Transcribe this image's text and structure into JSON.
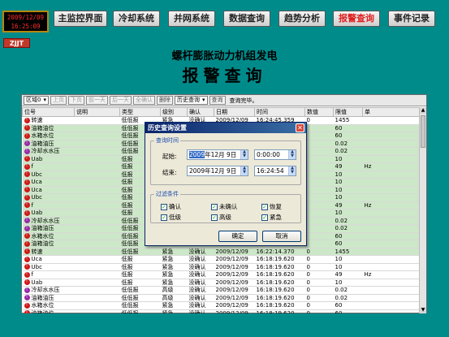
{
  "clock": {
    "date": "2009/12/09",
    "time": "16:25:09"
  },
  "logo": "ZJJT",
  "nav": [
    {
      "label": "主监控界面",
      "active": false
    },
    {
      "label": "冷却系统",
      "active": false
    },
    {
      "label": "并网系统",
      "active": false
    },
    {
      "label": "数据查询",
      "active": false
    },
    {
      "label": "趋势分析",
      "active": false
    },
    {
      "label": "报警查询",
      "active": true
    },
    {
      "label": "事件记录",
      "active": false
    }
  ],
  "title": "螺杆膨胀动力机组发电",
  "subtitle": "报警查询",
  "toolbar": {
    "area_select": "区域0",
    "prev_page": "上页",
    "next_page": "下页",
    "first_day": "前一天",
    "last_day": "后一天",
    "confirm": "全确认",
    "delete": "删除",
    "history": "历史查询",
    "query": "查询",
    "status": "查询完毕。"
  },
  "table": {
    "headers": [
      "位号",
      "说明",
      "类型",
      "级别",
      "确认",
      "日期",
      "时间",
      "数值",
      "限值",
      "单"
    ],
    "rows": [
      {
        "dot": "red",
        "tag": "转速",
        "type": "低低报",
        "level": "紧急",
        "ack": "没确认",
        "date": "2009/12/09",
        "time": "16:24:45.359",
        "value": "0",
        "limit": "1455",
        "unit": ""
      },
      {
        "dot": "red",
        "tag": "油箱油位",
        "type": "低低报",
        "level": "",
        "ack": "",
        "date": "",
        "time": "",
        "value": "",
        "limit": "60",
        "unit": ""
      },
      {
        "dot": "red",
        "tag": "水箱水位",
        "type": "低低报",
        "level": "",
        "ack": "",
        "date": "",
        "time": "",
        "value": "",
        "limit": "60",
        "unit": ""
      },
      {
        "dot": "purple",
        "tag": "油箱油压",
        "type": "低低报",
        "level": "",
        "ack": "",
        "date": "",
        "time": "",
        "value": "",
        "limit": "0.02",
        "unit": ""
      },
      {
        "dot": "purple",
        "tag": "冷却水水压",
        "type": "低低报",
        "level": "",
        "ack": "",
        "date": "",
        "time": "",
        "value": "",
        "limit": "0.02",
        "unit": ""
      },
      {
        "dot": "red",
        "tag": "Uab",
        "type": "低报",
        "level": "",
        "ack": "",
        "date": "",
        "time": "",
        "value": "",
        "limit": "10",
        "unit": ""
      },
      {
        "dot": "red",
        "tag": "f",
        "type": "低报",
        "level": "",
        "ack": "",
        "date": "",
        "time": "",
        "value": "",
        "limit": "49",
        "unit": "Hz"
      },
      {
        "dot": "red",
        "tag": "Ubc",
        "type": "低报",
        "level": "",
        "ack": "",
        "date": "",
        "time": "",
        "value": "",
        "limit": "10",
        "unit": ""
      },
      {
        "dot": "red",
        "tag": "Uca",
        "type": "低报",
        "level": "",
        "ack": "",
        "date": "",
        "time": "",
        "value": "",
        "limit": "10",
        "unit": ""
      },
      {
        "dot": "red",
        "tag": "Uca",
        "type": "低报",
        "level": "",
        "ack": "",
        "date": "",
        "time": "",
        "value": "",
        "limit": "10",
        "unit": ""
      },
      {
        "dot": "red",
        "tag": "Ubc",
        "type": "低报",
        "level": "",
        "ack": "",
        "date": "",
        "time": "",
        "value": "",
        "limit": "10",
        "unit": ""
      },
      {
        "dot": "red",
        "tag": "f",
        "type": "低报",
        "level": "",
        "ack": "",
        "date": "",
        "time": "",
        "value": "",
        "limit": "49",
        "unit": "Hz"
      },
      {
        "dot": "red",
        "tag": "Uab",
        "type": "低报",
        "level": "",
        "ack": "",
        "date": "",
        "time": "",
        "value": "",
        "limit": "10",
        "unit": ""
      },
      {
        "dot": "purple",
        "tag": "冷却水水压",
        "type": "低低报",
        "level": "",
        "ack": "",
        "date": "",
        "time": "",
        "value": "",
        "limit": "0.02",
        "unit": ""
      },
      {
        "dot": "purple",
        "tag": "油箱油压",
        "type": "低低报",
        "level": "",
        "ack": "",
        "date": "",
        "time": "",
        "value": "",
        "limit": "0.02",
        "unit": ""
      },
      {
        "dot": "red",
        "tag": "水箱水位",
        "type": "低低报",
        "level": "",
        "ack": "",
        "date": "",
        "time": "",
        "value": "",
        "limit": "60",
        "unit": ""
      },
      {
        "dot": "red",
        "tag": "油箱油位",
        "type": "低低报",
        "level": "",
        "ack": "",
        "date": "",
        "time": "",
        "value": "",
        "limit": "60",
        "unit": ""
      },
      {
        "dot": "red",
        "tag": "转速",
        "type": "低低报",
        "level": "紧急",
        "ack": "没确认",
        "date": "2009/12/09",
        "time": "16:22:14.370",
        "value": "0",
        "limit": "1455",
        "unit": ""
      },
      {
        "dot": "red",
        "tag": "Uca",
        "type": "低报",
        "level": "紧急",
        "ack": "没确认",
        "date": "2009/12/09",
        "time": "16:18:19.620",
        "value": "0",
        "limit": "10",
        "unit": ""
      },
      {
        "dot": "red",
        "tag": "Ubc",
        "type": "低报",
        "level": "紧急",
        "ack": "没确认",
        "date": "2009/12/09",
        "time": "16:18:19.620",
        "value": "0",
        "limit": "10",
        "unit": ""
      },
      {
        "dot": "red",
        "tag": "f",
        "type": "低报",
        "level": "紧急",
        "ack": "没确认",
        "date": "2009/12/09",
        "time": "16:18:19.620",
        "value": "0",
        "limit": "49",
        "unit": "Hz"
      },
      {
        "dot": "red",
        "tag": "Uab",
        "type": "低报",
        "level": "紧急",
        "ack": "没确认",
        "date": "2009/12/09",
        "time": "16:18:19.620",
        "value": "0",
        "limit": "10",
        "unit": ""
      },
      {
        "dot": "purple",
        "tag": "冷却水水压",
        "type": "低低报",
        "level": "高级",
        "ack": "没确认",
        "date": "2009/12/09",
        "time": "16:18:19.620",
        "value": "0",
        "limit": "0.02",
        "unit": ""
      },
      {
        "dot": "purple",
        "tag": "油箱油压",
        "type": "低低报",
        "level": "高级",
        "ack": "没确认",
        "date": "2009/12/09",
        "time": "16:18:19.620",
        "value": "0",
        "limit": "0.02",
        "unit": ""
      },
      {
        "dot": "red",
        "tag": "水箱水位",
        "type": "低低报",
        "level": "紧急",
        "ack": "没确认",
        "date": "2009/12/09",
        "time": "16:18:19.620",
        "value": "0",
        "limit": "60",
        "unit": ""
      },
      {
        "dot": "red",
        "tag": "油箱油位",
        "type": "低低报",
        "level": "紧急",
        "ack": "没确认",
        "date": "2009/12/09",
        "time": "16:18:19.620",
        "value": "0",
        "limit": "60",
        "unit": ""
      }
    ]
  },
  "dialog": {
    "title": "历史查询设置",
    "time_group": "查询时间",
    "start_label": "起始:",
    "start_year": "2009",
    "start_date_rest": "年12月 9日",
    "start_time": "0:00:00",
    "end_label": "结束:",
    "end_date": "2009年12月 9日",
    "end_time": "16:24:54",
    "filter_group": "过滤条件",
    "checkboxes": [
      {
        "label": "确认",
        "checked": true
      },
      {
        "label": "未确认",
        "checked": true
      },
      {
        "label": "恢复",
        "checked": true
      },
      {
        "label": "低级",
        "checked": true
      },
      {
        "label": "高级",
        "checked": true
      },
      {
        "label": "紧急",
        "checked": true
      }
    ],
    "ok": "确定",
    "cancel": "取消"
  },
  "colors": {
    "background": "#008b8b",
    "alarm_red": "#d01818",
    "alarm_purple": "#9a2aa8",
    "active_nav": "#e02020"
  }
}
